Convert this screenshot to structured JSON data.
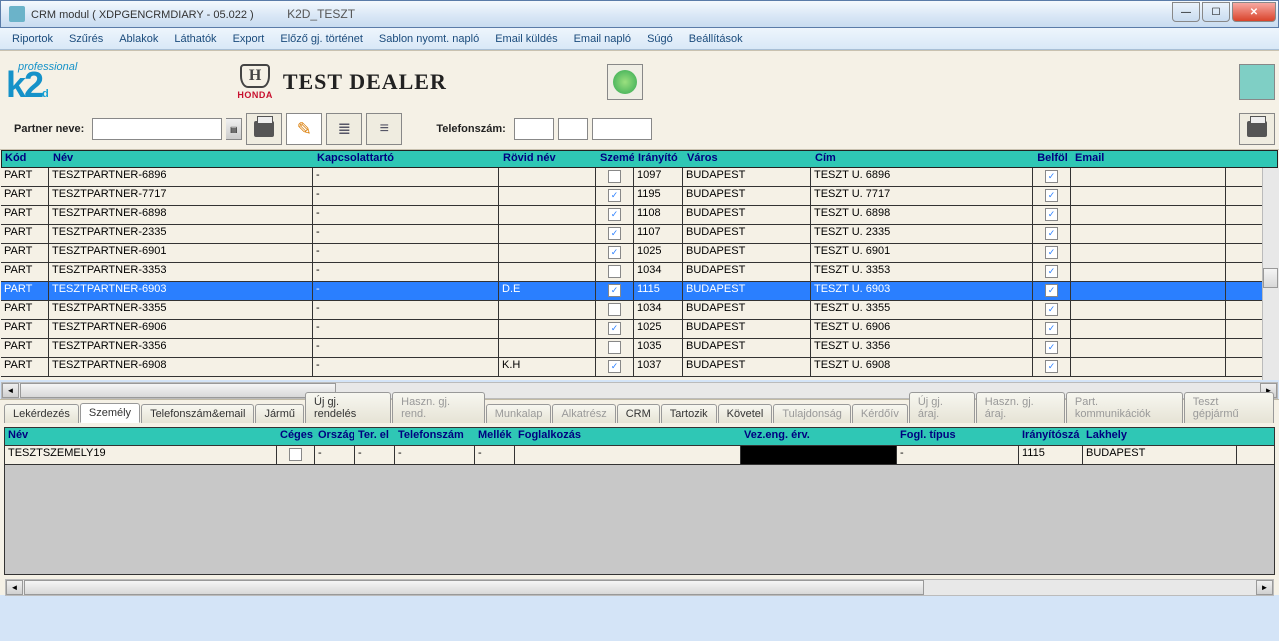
{
  "window": {
    "title": "CRM modul ( XDPGENCRMDIARY - 05.022 )",
    "subtitle": "K2D_TESZT"
  },
  "menu": [
    "Riportok",
    "Szűrés",
    "Ablakok",
    "Láthatók",
    "Export",
    "Előző gj. történet",
    "Sablon nyomt. napló",
    "Email küldés",
    "Email napló",
    "Súgó",
    "Beállítások"
  ],
  "brand": {
    "prof": "professional",
    "logo": "k2d",
    "honda": "HONDA",
    "dealer": "TEST DEALER"
  },
  "fields": {
    "partner_label": "Partner neve:",
    "telefon_label": "Telefonszám:"
  },
  "grid": {
    "headers": {
      "kod": "Kód",
      "nev": "Név",
      "kapcs": "Kapcsolattartó",
      "rovid": "Rövid név",
      "szem": "Szemé",
      "irany": "Irányító",
      "varos": "Város",
      "cim": "Cím",
      "belf": "Belföl",
      "email": "Email"
    },
    "rows": [
      {
        "kod": "PART",
        "nev": "TESZTPARTNER-6896",
        "kapcs": "-",
        "rovid": "",
        "szem": false,
        "irany": "1097",
        "varos": "BUDAPEST",
        "cim": "TESZT U. 6896",
        "belf": true,
        "email": ""
      },
      {
        "kod": "PART",
        "nev": "TESZTPARTNER-7717",
        "kapcs": "-",
        "rovid": "",
        "szem": true,
        "irany": "1195",
        "varos": "BUDAPEST",
        "cim": "TESZT U. 7717",
        "belf": true,
        "email": ""
      },
      {
        "kod": "PART",
        "nev": "TESZTPARTNER-6898",
        "kapcs": "-",
        "rovid": "",
        "szem": true,
        "irany": "1108",
        "varos": "BUDAPEST",
        "cim": "TESZT U. 6898",
        "belf": true,
        "email": ""
      },
      {
        "kod": "PART",
        "nev": "TESZTPARTNER-2335",
        "kapcs": "-",
        "rovid": "",
        "szem": true,
        "irany": "1107",
        "varos": "BUDAPEST",
        "cim": "TESZT U. 2335",
        "belf": true,
        "email": ""
      },
      {
        "kod": "PART",
        "nev": "TESZTPARTNER-6901",
        "kapcs": "-",
        "rovid": "",
        "szem": true,
        "irany": "1025",
        "varos": "BUDAPEST",
        "cim": "TESZT U. 6901",
        "belf": true,
        "email": ""
      },
      {
        "kod": "PART",
        "nev": "TESZTPARTNER-3353",
        "kapcs": "-",
        "rovid": "",
        "szem": false,
        "irany": "1034",
        "varos": "BUDAPEST",
        "cim": "TESZT U. 3353",
        "belf": true,
        "email": ""
      },
      {
        "kod": "PART",
        "nev": "TESZTPARTNER-6903",
        "kapcs": "-",
        "rovid": "D.E",
        "szem": true,
        "irany": "1115",
        "varos": "BUDAPEST",
        "cim": "TESZT U. 6903",
        "belf": true,
        "email": "",
        "selected": true
      },
      {
        "kod": "PART",
        "nev": "TESZTPARTNER-3355",
        "kapcs": "-",
        "rovid": "",
        "szem": false,
        "irany": "1034",
        "varos": "BUDAPEST",
        "cim": "TESZT U. 3355",
        "belf": true,
        "email": ""
      },
      {
        "kod": "PART",
        "nev": "TESZTPARTNER-6906",
        "kapcs": "-",
        "rovid": "",
        "szem": true,
        "irany": "1025",
        "varos": "BUDAPEST",
        "cim": "TESZT U. 6906",
        "belf": true,
        "email": ""
      },
      {
        "kod": "PART",
        "nev": "TESZTPARTNER-3356",
        "kapcs": "-",
        "rovid": "",
        "szem": false,
        "irany": "1035",
        "varos": "BUDAPEST",
        "cim": "TESZT U. 3356",
        "belf": true,
        "email": ""
      },
      {
        "kod": "PART",
        "nev": "TESZTPARTNER-6908",
        "kapcs": "-",
        "rovid": "K.H",
        "szem": true,
        "irany": "1037",
        "varos": "BUDAPEST",
        "cim": "TESZT U. 6908",
        "belf": true,
        "email": ""
      }
    ]
  },
  "tabs": [
    {
      "label": "Lekérdezés",
      "active": false,
      "disabled": false
    },
    {
      "label": "Személy",
      "active": true,
      "disabled": false
    },
    {
      "label": "Telefonszám&email",
      "active": false,
      "disabled": false
    },
    {
      "label": "Jármű",
      "active": false,
      "disabled": false
    },
    {
      "label": "Új gj. rendelés",
      "active": false,
      "disabled": false
    },
    {
      "label": "Haszn. gj. rend.",
      "active": false,
      "disabled": true
    },
    {
      "label": "Munkalap",
      "active": false,
      "disabled": true
    },
    {
      "label": "Alkatrész",
      "active": false,
      "disabled": true
    },
    {
      "label": "CRM",
      "active": false,
      "disabled": false
    },
    {
      "label": "Tartozik",
      "active": false,
      "disabled": false
    },
    {
      "label": "Követel",
      "active": false,
      "disabled": false
    },
    {
      "label": "Tulajdonság",
      "active": false,
      "disabled": true
    },
    {
      "label": "Kérdőív",
      "active": false,
      "disabled": true
    },
    {
      "label": "Új gj. áraj.",
      "active": false,
      "disabled": true
    },
    {
      "label": "Haszn. gj. áraj.",
      "active": false,
      "disabled": true
    },
    {
      "label": "Part. kommunikációk",
      "active": false,
      "disabled": true
    },
    {
      "label": "Teszt gépjármű",
      "active": false,
      "disabled": true
    }
  ],
  "detail": {
    "headers": {
      "nev": "Név",
      "ceges": "Céges",
      "orsz": "Ország",
      "ter": "Ter. el",
      "tel": "Telefonszám",
      "mellek": "Mellék",
      "fogl": "Foglalkozás",
      "vezeng": "Vez.eng. érv.",
      "fogltip": "Fogl. típus",
      "irsz": "Irányítószá",
      "lakhely": "Lakhely"
    },
    "rows": [
      {
        "nev": "TESZTSZEMELY19",
        "ceges": false,
        "orsz": "-",
        "ter": "-",
        "tel": "-",
        "mellek": "-",
        "fogl": "",
        "vezeng": "",
        "fogltip": "-",
        "irsz": "1115",
        "lakhely": "BUDAPEST"
      }
    ]
  }
}
